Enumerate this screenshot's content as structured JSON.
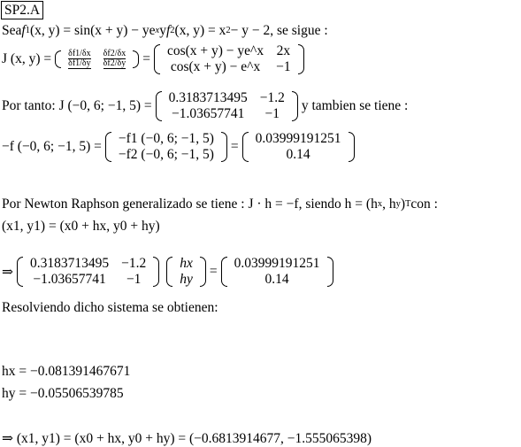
{
  "label": "SP2.A",
  "l1": {
    "a": "Sea ",
    "b": "f",
    "b1": "1",
    "c": "(x, y) = sin(x + y) − ye",
    "cx": "x",
    "d": " y ",
    "e": "f",
    "e1": "2",
    "f": "(x, y) = x",
    "f2": "2",
    "g": " − y − 2,  se sigue :"
  },
  "l2": {
    "a": "J (x, y) = ",
    "partials": [
      "δf1/δx",
      "δf2/δx",
      "δf1/δy",
      "δf2/δy"
    ],
    "eq": " = ",
    "m": [
      "cos(x + y) − ye^x",
      "2x",
      "cos(x + y) − e^x",
      "−1"
    ]
  },
  "l3": {
    "a": "Por tanto:  J (−0, 6; −1, 5) = ",
    "m": [
      "0.3183713495",
      "−1.2",
      "−1.03657741",
      "−1"
    ],
    "b": " y tambien se tiene :"
  },
  "l4": {
    "a": "−f (−0, 6; −1, 5) = ",
    "v1": [
      "−f1 (−0, 6; −1, 5)",
      "−f2 (−0, 6; −1, 5)"
    ],
    "eq": " = ",
    "v2": [
      "0.03999191251",
      "0.14"
    ]
  },
  "l5": {
    "a": "Por Newton Raphson generalizado se tiene :  J · h = −f, siendo h = (h",
    "x": "x",
    "b": ", h",
    "y": "y",
    "c": ")",
    "T": "T",
    "d": " con :"
  },
  "l6": "(x1, y1) = (x0 + hx, y0 + hy)",
  "l7": {
    "a": "⇒",
    "m": [
      "0.3183713495",
      "−1.2",
      "−1.03657741",
      "−1"
    ],
    "h": [
      "hx",
      "hy"
    ],
    "eq": " = ",
    "v": [
      "0.03999191251",
      "0.14"
    ]
  },
  "l8": "Resolviendo dicho sistema se obtienen:",
  "hx": "hx = −0.081391467671",
  "hy": "hy = −0.05506539785",
  "final": "⇒ (x1, y1) = (x0 + hx, y0 + hy) = (−0.6813914677, −1.555065398)"
}
